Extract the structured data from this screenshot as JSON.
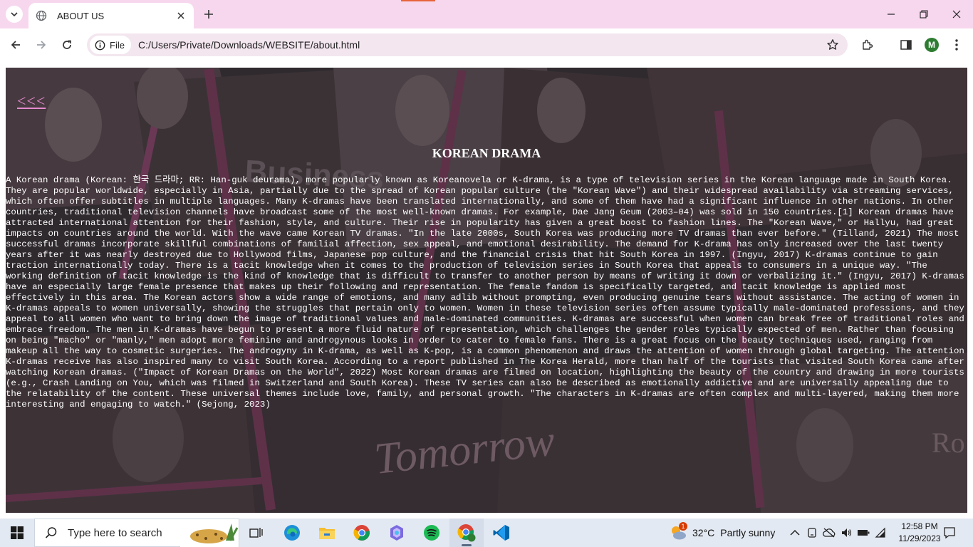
{
  "browser": {
    "tab_title": "ABOUT US",
    "site_chip_label": "File",
    "url": "C:/Users/Private/Downloads/WEBSITE/about.html",
    "profile_initial": "M"
  },
  "page": {
    "back_link": "<<<",
    "title": "KOREAN DRAMA",
    "body": "A Korean drama (Korean: 한국 드라마; RR: Han-guk deurama), more popularly known as Koreanovela or K-drama, is a type of television series in the Korean language made in South Korea. They are popular worldwide, especially in Asia, partially due to the spread of Korean popular culture (the \"Korean Wave\") and their widespread availability via streaming services, which often offer subtitles in multiple languages. Many K-dramas have been translated internationally, and some of them have had a significant influence in other nations. In other countries, traditional television channels have broadcast some of the most well-known dramas. For example, Dae Jang Geum (2003–04) was sold in 150 countries.[1] Korean dramas have attracted international attention for their fashion, style, and culture. Their rise in popularity has given a great boost to fashion lines. The \"Korean Wave,\" or Hallyu, had great impacts on countries around the world. With the wave came Korean TV dramas. \"In the late 2000s, South Korea was producing more TV dramas than ever before.\" (Tilland, 2021) The most successful dramas incorporate skillful combinations of familial affection, sex appeal, and emotional desirability. The demand for K-drama has only increased over the last twenty years after it was nearly destroyed due to Hollywood films, Japanese pop culture, and the financial crisis that hit South Korea in 1997. (Ingyu, 2017) K-dramas continue to gain traction internationally today. There is a tacit knowledge when it comes to the production of television series in South Korea that appeals to consumers in a unique way. \"The working definition of tacit knowledge is the kind of knowledge that is difficult to transfer to another person by means of writing it down or verbalizing it.\" (Ingyu, 2017) K-dramas have an especially large female presence that makes up their following and representation. The female fandom is specifically targeted, and tacit knowledge is applied most effectively in this area. The Korean actors show a wide range of emotions, and many adlib without prompting, even producing genuine tears without assistance. The acting of women in K-dramas appeals to women universally, showing the struggles that pertain only to women. Women in these television series often assume typically male-dominated professions, and they appeal to all women who want to bring down the image of traditional values and male-dominated communities. K-dramas are successful when women can break free of traditional roles and embrace freedom. The men in K-dramas have begun to present a more fluid nature of representation, which challenges the gender roles typically expected of men. Rather than focusing on being \"macho\" or \"manly,\" men adopt more feminine and androgynous looks in order to cater to female fans. There is a great focus on the beauty techniques used, ranging from makeup all the way to cosmetic surgeries. The androgyny in K-drama, as well as K-pop, is a common phenomenon and draws the attention of women through global targeting. The attention K-dramas receive has also inspired many to visit South Korea. According to a report published in The Korea Herald, more than half of the tourists that visited South Korea came after watching Korean dramas. (\"Impact of Korean Dramas on the World\", 2022) Most Korean dramas are filmed on location, highlighting the beauty of the country and drawing in more tourists (e.g., Crash Landing on You, which was filmed in Switzerland and South Korea). These TV series can also be described as emotionally addictive and are universally appealing due to the relatability of the content. These universal themes include love, family, and personal growth. \"The characters in K-dramas are often complex and multi-layered, making them more interesting and engaging to watch.\" (Sejong, 2023)",
    "bg_words": [
      "Business",
      "Tomorrow",
      "Ro"
    ]
  },
  "taskbar": {
    "search_placeholder": "Type here to search",
    "weather_badge": "1",
    "weather_temp": "32°C",
    "weather_desc": "Partly sunny",
    "time": "12:58 PM",
    "date": "11/29/2023"
  },
  "colors": {
    "tab_strip": "#f7d7ee",
    "omnibox": "#f3e6ef",
    "page_bg": "#2f2a2e",
    "back_link": "#e58bd0",
    "taskbar": "#e3e9f2"
  }
}
